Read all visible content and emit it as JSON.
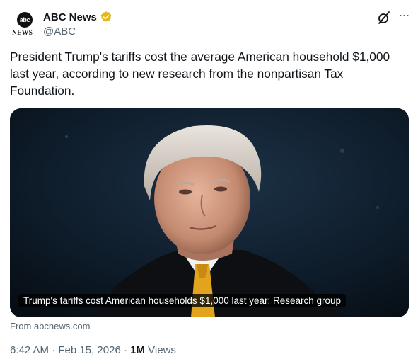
{
  "account": {
    "avatar_logo": "abc",
    "avatar_sub": "NEWS",
    "name": "ABC News",
    "handle": "@ABC",
    "verified_color": "#E2B719"
  },
  "actions": {
    "grok_icon": "grok-icon",
    "more_icon": "more-icon",
    "more_glyph": "···"
  },
  "tweet": {
    "text": "President Trump's tariffs cost the average American household $1,000\nlast year, according to new research from the nonpartisan Tax\nFoundation."
  },
  "card": {
    "caption": "Trump's tariffs cost American households $1,000 last year: Research group",
    "source": "From abcnews.com"
  },
  "meta": {
    "time": "6:42 AM",
    "separator": "·",
    "date": "Feb 15, 2026",
    "views_count": "1M",
    "views_label": "Views"
  }
}
